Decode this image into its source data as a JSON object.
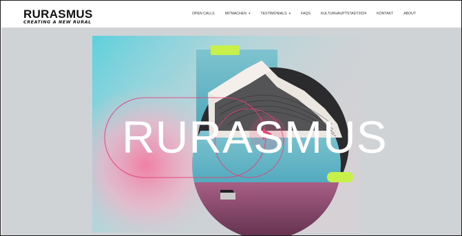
{
  "header": {
    "logo_title": "RURASMUS",
    "logo_tagline": "CREATING A NEW RURAL"
  },
  "nav": {
    "items": [
      {
        "label": "OPEN CALLS",
        "has_dropdown": false
      },
      {
        "label": "MITMACHEN",
        "has_dropdown": true
      },
      {
        "label": "TESTIMONIALS",
        "has_dropdown": true
      },
      {
        "label": "FAQS",
        "has_dropdown": false
      },
      {
        "label": "KULTURHAUPTSTADT2024",
        "has_dropdown": false
      },
      {
        "label": "KONTAKT",
        "has_dropdown": false
      },
      {
        "label": "ABOUT",
        "has_dropdown": false
      }
    ]
  },
  "hero": {
    "title": "RURASMUS",
    "play_icon": "play-icon",
    "colors": {
      "background": "#d0d3d5",
      "accent_pink": "#e8477a",
      "accent_lime": "#c8f04a",
      "accent_cyan": "#3fc6d6"
    }
  }
}
